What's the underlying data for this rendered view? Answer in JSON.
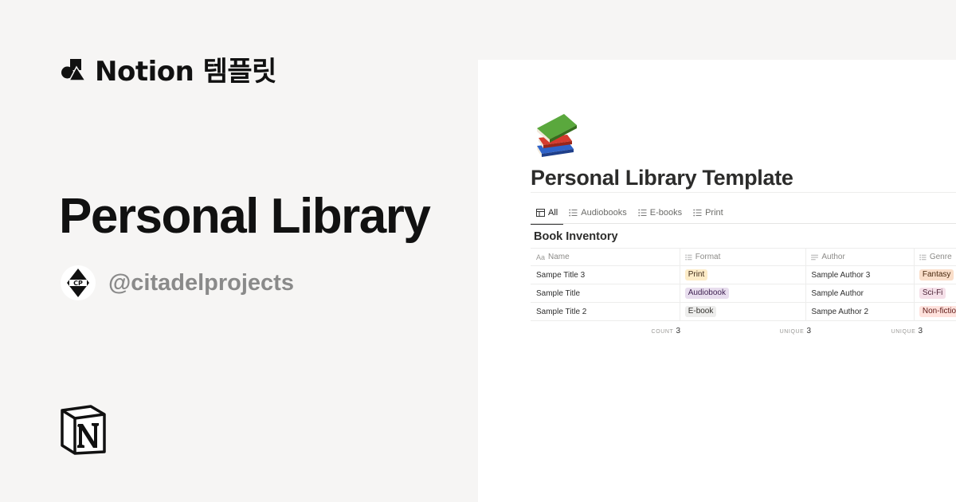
{
  "brand": {
    "text": "Notion 템플릿",
    "icon": "shapes-icon"
  },
  "hero": {
    "title": "Personal Library",
    "handle": "@citadelprojects",
    "avatar_initials": "CP"
  },
  "preview": {
    "emoji": "books-icon",
    "page_title": "Personal Library Template",
    "tabs": [
      {
        "label": "All",
        "icon": "table-icon",
        "active": true
      },
      {
        "label": "Audiobooks",
        "icon": "list-icon",
        "active": false
      },
      {
        "label": "E-books",
        "icon": "list-icon",
        "active": false
      },
      {
        "label": "Print",
        "icon": "list-icon",
        "active": false
      }
    ],
    "database_title": "Book Inventory",
    "columns": [
      {
        "label": "Name",
        "icon": "Aa"
      },
      {
        "label": "Format",
        "icon": "list-icon"
      },
      {
        "label": "Author",
        "icon": "text-icon"
      },
      {
        "label": "Genre",
        "icon": "list-icon"
      }
    ],
    "rows": [
      {
        "name": "Sampe Title 3",
        "format": "Print",
        "author": "Sample Author 3",
        "genre": "Fantasy"
      },
      {
        "name": "Sample Title",
        "format": "Audiobook",
        "author": "Sample Author",
        "genre": "Sci-Fi"
      },
      {
        "name": "Sample Title 2",
        "format": "E-book",
        "author": "Sampe Author 2",
        "genre": "Non-fiction"
      }
    ],
    "footer": [
      {
        "label": "COUNT",
        "value": "3"
      },
      {
        "label": "UNIQUE",
        "value": "3"
      },
      {
        "label": "UNIQUE",
        "value": "3"
      }
    ]
  },
  "colors": {
    "background": "#f6f5f4",
    "tag_print": "#fdecc8",
    "tag_audiobook": "#e8deee",
    "tag_ebook": "#ededec",
    "tag_fantasy": "#fadec9",
    "tag_scifi": "#f5e0e9",
    "tag_nonfiction": "#ffe2dd"
  }
}
